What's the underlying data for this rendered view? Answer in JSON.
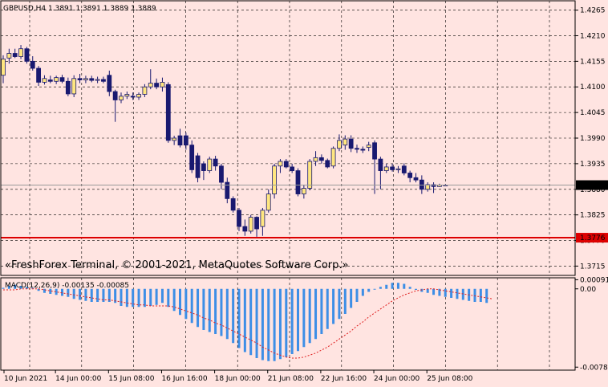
{
  "header": {
    "symbol_info": "GBPUSD,H4  1.3891 1.3891 1.3889 1.3889"
  },
  "watermark": "«FreshForex Terminal, © 2001-2021, MetaQuotes Software Corp.»",
  "colors": {
    "background": "#ffe4e1",
    "grid": "#000000",
    "bull_candle_body": "#ffe680",
    "bear_candle_body": "#191970",
    "wick": "#191970",
    "macd_histogram": "#3d8ee6",
    "macd_signal": "#e02020",
    "support_line": "#dd0000",
    "price_line": "#9a9a9a"
  },
  "chart_data": [
    {
      "type": "candlestick",
      "symbol": "GBPUSD",
      "timeframe": "H4",
      "ylim": [
        1.3695,
        1.4285
      ],
      "y_ticks": [
        "1.4265",
        "1.4210",
        "1.4155",
        "1.4100",
        "1.4045",
        "1.3990",
        "1.3935",
        "1.3880",
        "1.3825",
        "1.3770",
        "1.3715"
      ],
      "x_ticks": [
        "10 Jun 2021",
        "14 Jun 00:00",
        "15 Jun 08:00",
        "16 Jun 16:00",
        "18 Jun 00:00",
        "21 Jun 08:00",
        "22 Jun 16:00",
        "24 Jun 00:00",
        "25 Jun 08:00"
      ],
      "current_price": "1.3889",
      "current_price_value": 1.3889,
      "horizontal_line": {
        "label": "1.3776",
        "value": 1.3776
      },
      "candles": [
        {
          "o": 1.4125,
          "h": 1.4168,
          "l": 1.4108,
          "c": 1.416
        },
        {
          "o": 1.4162,
          "h": 1.4182,
          "l": 1.415,
          "c": 1.4172
        },
        {
          "o": 1.4172,
          "h": 1.4182,
          "l": 1.4162,
          "c": 1.4165
        },
        {
          "o": 1.4165,
          "h": 1.419,
          "l": 1.416,
          "c": 1.4182
        },
        {
          "o": 1.4182,
          "h": 1.4186,
          "l": 1.415,
          "c": 1.4155
        },
        {
          "o": 1.4155,
          "h": 1.4166,
          "l": 1.4135,
          "c": 1.414
        },
        {
          "o": 1.414,
          "h": 1.4145,
          "l": 1.4102,
          "c": 1.411
        },
        {
          "o": 1.411,
          "h": 1.4125,
          "l": 1.4105,
          "c": 1.4118
        },
        {
          "o": 1.4115,
          "h": 1.4124,
          "l": 1.4108,
          "c": 1.4112
        },
        {
          "o": 1.4112,
          "h": 1.4124,
          "l": 1.4106,
          "c": 1.412
        },
        {
          "o": 1.412,
          "h": 1.4126,
          "l": 1.4108,
          "c": 1.4112
        },
        {
          "o": 1.4112,
          "h": 1.412,
          "l": 1.408,
          "c": 1.4085
        },
        {
          "o": 1.4085,
          "h": 1.4125,
          "l": 1.4078,
          "c": 1.4118
        },
        {
          "o": 1.4118,
          "h": 1.4128,
          "l": 1.4108,
          "c": 1.4115
        },
        {
          "o": 1.4115,
          "h": 1.4124,
          "l": 1.4108,
          "c": 1.4118
        },
        {
          "o": 1.4118,
          "h": 1.4124,
          "l": 1.411,
          "c": 1.4114
        },
        {
          "o": 1.4114,
          "h": 1.4122,
          "l": 1.4108,
          "c": 1.4116
        },
        {
          "o": 1.4116,
          "h": 1.4122,
          "l": 1.4108,
          "c": 1.4112
        },
        {
          "o": 1.4125,
          "h": 1.4135,
          "l": 1.408,
          "c": 1.409
        },
        {
          "o": 1.409,
          "h": 1.4094,
          "l": 1.4025,
          "c": 1.4072
        },
        {
          "o": 1.4072,
          "h": 1.4088,
          "l": 1.4065,
          "c": 1.408
        },
        {
          "o": 1.408,
          "h": 1.409,
          "l": 1.4074,
          "c": 1.4084
        },
        {
          "o": 1.408,
          "h": 1.4088,
          "l": 1.4072,
          "c": 1.4078
        },
        {
          "o": 1.4078,
          "h": 1.4088,
          "l": 1.4072,
          "c": 1.4084
        },
        {
          "o": 1.4084,
          "h": 1.4106,
          "l": 1.4078,
          "c": 1.41
        },
        {
          "o": 1.41,
          "h": 1.4138,
          "l": 1.4095,
          "c": 1.4108
        },
        {
          "o": 1.4108,
          "h": 1.4118,
          "l": 1.4095,
          "c": 1.41
        },
        {
          "o": 1.41,
          "h": 1.412,
          "l": 1.409,
          "c": 1.411
        },
        {
          "o": 1.4105,
          "h": 1.411,
          "l": 1.398,
          "c": 1.3985
        },
        {
          "o": 1.3985,
          "h": 1.3995,
          "l": 1.3975,
          "c": 1.399
        },
        {
          "o": 1.3995,
          "h": 1.401,
          "l": 1.397,
          "c": 1.3975
        },
        {
          "o": 1.3995,
          "h": 1.4002,
          "l": 1.3965,
          "c": 1.3975
        },
        {
          "o": 1.3975,
          "h": 1.3985,
          "l": 1.3915,
          "c": 1.3922
        },
        {
          "o": 1.3952,
          "h": 1.3958,
          "l": 1.3895,
          "c": 1.3905
        },
        {
          "o": 1.3935,
          "h": 1.394,
          "l": 1.39,
          "c": 1.392
        },
        {
          "o": 1.392,
          "h": 1.395,
          "l": 1.3915,
          "c": 1.3945
        },
        {
          "o": 1.3945,
          "h": 1.3952,
          "l": 1.392,
          "c": 1.393
        },
        {
          "o": 1.393,
          "h": 1.3935,
          "l": 1.388,
          "c": 1.3895
        },
        {
          "o": 1.3895,
          "h": 1.3905,
          "l": 1.385,
          "c": 1.386
        },
        {
          "o": 1.386,
          "h": 1.3865,
          "l": 1.383,
          "c": 1.3835
        },
        {
          "o": 1.3835,
          "h": 1.384,
          "l": 1.379,
          "c": 1.38
        },
        {
          "o": 1.38,
          "h": 1.3815,
          "l": 1.378,
          "c": 1.379
        },
        {
          "o": 1.379,
          "h": 1.3825,
          "l": 1.3785,
          "c": 1.382
        },
        {
          "o": 1.382,
          "h": 1.3822,
          "l": 1.3778,
          "c": 1.3795
        },
        {
          "o": 1.38,
          "h": 1.384,
          "l": 1.378,
          "c": 1.3835
        },
        {
          "o": 1.3835,
          "h": 1.388,
          "l": 1.383,
          "c": 1.387
        },
        {
          "o": 1.387,
          "h": 1.3935,
          "l": 1.386,
          "c": 1.393
        },
        {
          "o": 1.393,
          "h": 1.3945,
          "l": 1.3915,
          "c": 1.394
        },
        {
          "o": 1.394,
          "h": 1.3945,
          "l": 1.3925,
          "c": 1.3928
        },
        {
          "o": 1.3928,
          "h": 1.3935,
          "l": 1.3915,
          "c": 1.392
        },
        {
          "o": 1.392,
          "h": 1.3925,
          "l": 1.3865,
          "c": 1.387
        },
        {
          "o": 1.387,
          "h": 1.389,
          "l": 1.386,
          "c": 1.3882
        },
        {
          "o": 1.3882,
          "h": 1.3945,
          "l": 1.3878,
          "c": 1.394
        },
        {
          "o": 1.394,
          "h": 1.3962,
          "l": 1.393,
          "c": 1.3948
        },
        {
          "o": 1.3948,
          "h": 1.3955,
          "l": 1.3935,
          "c": 1.3942
        },
        {
          "o": 1.3942,
          "h": 1.3946,
          "l": 1.3925,
          "c": 1.3928
        },
        {
          "o": 1.393,
          "h": 1.3972,
          "l": 1.3925,
          "c": 1.3968
        },
        {
          "o": 1.3968,
          "h": 1.3998,
          "l": 1.3962,
          "c": 1.3985
        },
        {
          "o": 1.3975,
          "h": 1.3996,
          "l": 1.3965,
          "c": 1.3988
        },
        {
          "o": 1.3988,
          "h": 1.3996,
          "l": 1.396,
          "c": 1.3968
        },
        {
          "o": 1.3968,
          "h": 1.3976,
          "l": 1.3958,
          "c": 1.3966
        },
        {
          "o": 1.3966,
          "h": 1.3972,
          "l": 1.3958,
          "c": 1.3964
        },
        {
          "o": 1.397,
          "h": 1.3982,
          "l": 1.3962,
          "c": 1.3975
        },
        {
          "o": 1.398,
          "h": 1.3985,
          "l": 1.387,
          "c": 1.3945
        },
        {
          "o": 1.3945,
          "h": 1.395,
          "l": 1.388,
          "c": 1.392
        },
        {
          "o": 1.392,
          "h": 1.3935,
          "l": 1.3915,
          "c": 1.3928
        },
        {
          "o": 1.3928,
          "h": 1.3935,
          "l": 1.3918,
          "c": 1.3922
        },
        {
          "o": 1.3922,
          "h": 1.393,
          "l": 1.3915,
          "c": 1.3924
        },
        {
          "o": 1.393,
          "h": 1.3936,
          "l": 1.391,
          "c": 1.3915
        },
        {
          "o": 1.3915,
          "h": 1.392,
          "l": 1.3895,
          "c": 1.3905
        },
        {
          "o": 1.3905,
          "h": 1.3915,
          "l": 1.3895,
          "c": 1.39
        },
        {
          "o": 1.39,
          "h": 1.391,
          "l": 1.387,
          "c": 1.388
        },
        {
          "o": 1.388,
          "h": 1.3895,
          "l": 1.3875,
          "c": 1.389
        },
        {
          "o": 1.389,
          "h": 1.3895,
          "l": 1.3872,
          "c": 1.3886
        },
        {
          "o": 1.3886,
          "h": 1.3892,
          "l": 1.3885,
          "c": 1.3889
        },
        {
          "o": 1.3889,
          "h": 1.3891,
          "l": 1.3888,
          "c": 1.3889
        }
      ]
    },
    {
      "type": "bar",
      "indicator": "MACD",
      "label": "MACD(12,26,9) -0.00135 -0.00085",
      "ylim": [
        -0.0081,
        0.0011
      ],
      "y_ticks": [
        "0.00091",
        "0.00",
        "-0.0078"
      ],
      "histogram": [
        0.0001,
        0.0003,
        0.0004,
        0.0003,
        0.0002,
        0.0001,
        -0.0002,
        -0.0004,
        -0.0005,
        -0.0006,
        -0.0007,
        -0.0008,
        -0.001,
        -0.0011,
        -0.0012,
        -0.0013,
        -0.0013,
        -0.0013,
        -0.0013,
        -0.0014,
        -0.0017,
        -0.0018,
        -0.0018,
        -0.0018,
        -0.0018,
        -0.0017,
        -0.0016,
        -0.0014,
        -0.0018,
        -0.0022,
        -0.0026,
        -0.003,
        -0.0034,
        -0.0038,
        -0.0041,
        -0.0043,
        -0.0045,
        -0.0047,
        -0.005,
        -0.0054,
        -0.0059,
        -0.0063,
        -0.0066,
        -0.0069,
        -0.0071,
        -0.0072,
        -0.0072,
        -0.007,
        -0.0068,
        -0.0065,
        -0.0062,
        -0.0058,
        -0.0054,
        -0.005,
        -0.0045,
        -0.004,
        -0.0035,
        -0.003,
        -0.0025,
        -0.0019,
        -0.0013,
        -0.0007,
        -0.0003,
        0.0,
        0.0002,
        0.0004,
        0.0006,
        0.0006,
        0.0005,
        0.0002,
        -0.0001,
        -0.0003,
        -0.0004,
        -0.0006,
        -0.0007,
        -0.0008,
        -0.0009,
        -0.001,
        -0.0011,
        -0.0012,
        -0.0013,
        -0.0013,
        -0.0014
      ],
      "signal": [
        -0.0001,
        -0.0001,
        -0.0001,
        0.0,
        0.0,
        0.0,
        0.0,
        -0.0001,
        -0.0002,
        -0.0003,
        -0.0004,
        -0.0005,
        -0.0006,
        -0.0007,
        -0.0008,
        -0.0009,
        -0.001,
        -0.0011,
        -0.0011,
        -0.0012,
        -0.0013,
        -0.0014,
        -0.0015,
        -0.0016,
        -0.0016,
        -0.0017,
        -0.0017,
        -0.0017,
        -0.0017,
        -0.0018,
        -0.002,
        -0.0022,
        -0.0024,
        -0.0026,
        -0.0029,
        -0.0031,
        -0.0034,
        -0.0036,
        -0.0039,
        -0.0042,
        -0.0045,
        -0.0048,
        -0.0051,
        -0.0054,
        -0.0058,
        -0.0061,
        -0.0064,
        -0.0066,
        -0.0068,
        -0.0069,
        -0.0069,
        -0.0068,
        -0.0066,
        -0.0064,
        -0.0061,
        -0.0058,
        -0.0054,
        -0.005,
        -0.0046,
        -0.0042,
        -0.0037,
        -0.0033,
        -0.0028,
        -0.0024,
        -0.002,
        -0.0016,
        -0.0012,
        -0.0009,
        -0.0006,
        -0.0004,
        -0.0002,
        -0.0001,
        0.0,
        0.0,
        -0.0001,
        -0.0002,
        -0.0003,
        -0.0004,
        -0.0005,
        -0.0006,
        -0.0007,
        -0.0008,
        -0.0009,
        -0.001
      ]
    }
  ]
}
